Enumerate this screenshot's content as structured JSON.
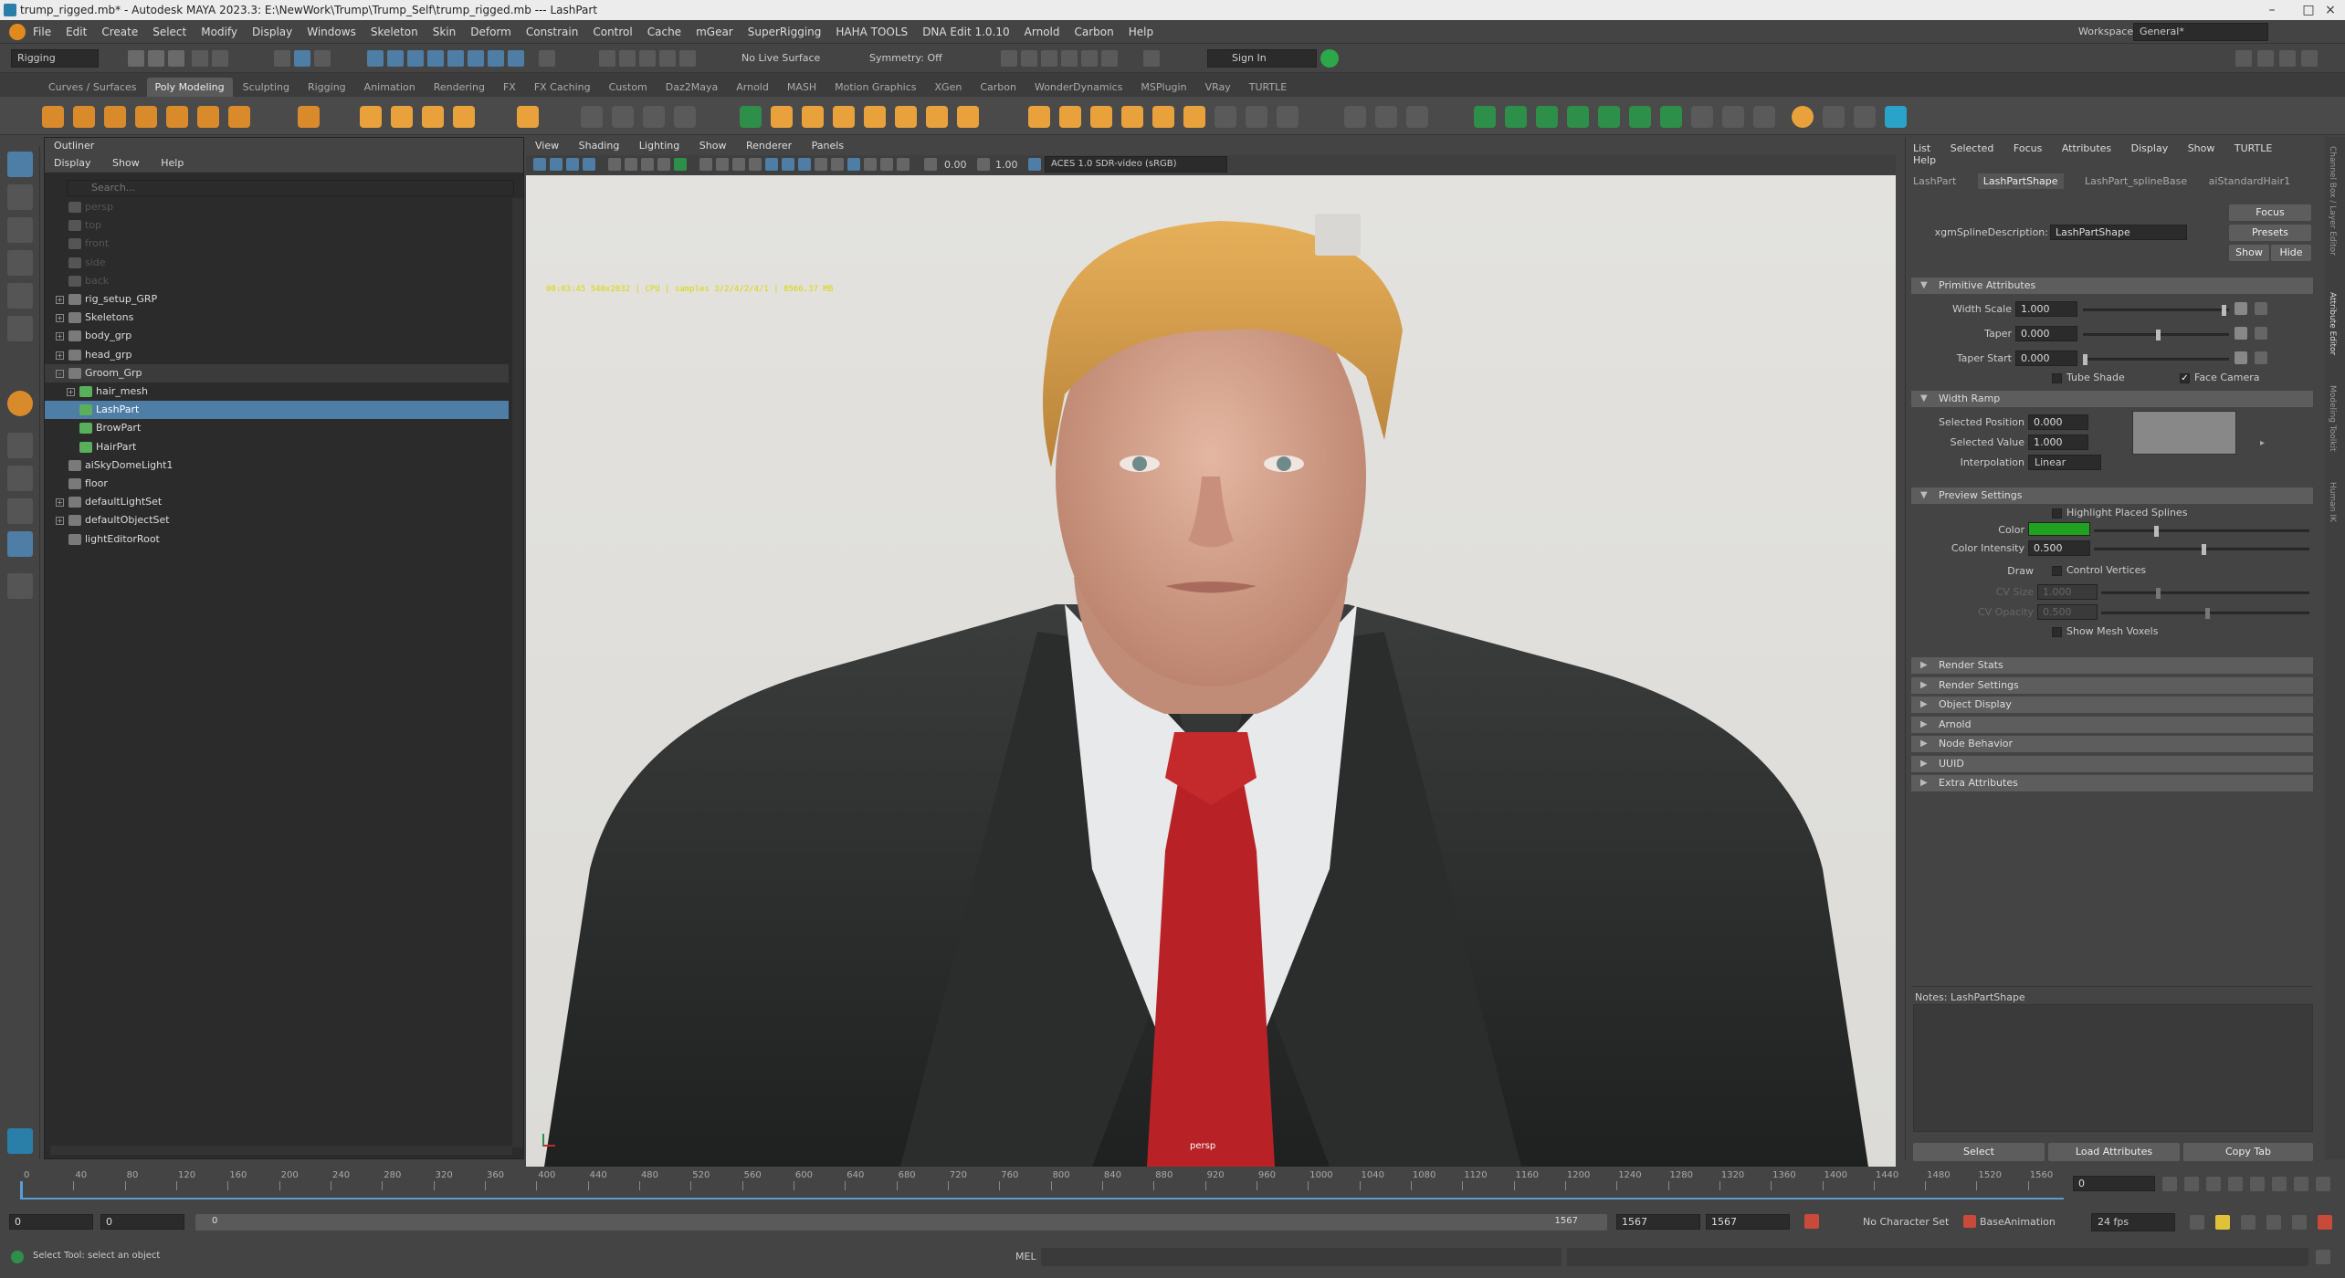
{
  "window": {
    "title": "trump_rigged.mb* - Autodesk MAYA 2023.3: E:\\NewWork\\Trump\\Trump_Self\\trump_rigged.mb  ---  LashPart"
  },
  "menubar": {
    "items": [
      "File",
      "Edit",
      "Create",
      "Select",
      "Modify",
      "Display",
      "Windows",
      "Skeleton",
      "Skin",
      "Deform",
      "Constrain",
      "Control",
      "Cache",
      "mGear",
      "SuperRigging",
      "HAHA TOOLS",
      "DNA Edit 1.0.10",
      "Arnold",
      "Carbon",
      "Help"
    ],
    "workspace_label": "Workspace:",
    "workspace_value": "General*"
  },
  "statusline": {
    "mode": "Rigging",
    "live_surface": "No Live Surface",
    "symmetry": "Symmetry: Off",
    "sign_in": "Sign In"
  },
  "shelf": {
    "tabs": [
      "Curves / Surfaces",
      "Poly Modeling",
      "Sculpting",
      "Rigging",
      "Animation",
      "Rendering",
      "FX",
      "FX Caching",
      "Custom",
      "Daz2Maya",
      "Arnold",
      "MASH",
      "Motion Graphics",
      "XGen",
      "Carbon",
      "WonderDynamics",
      "MSPlugin",
      "VRay",
      "TURTLE"
    ],
    "active": "Poly Modeling"
  },
  "outliner": {
    "title": "Outliner",
    "menu": [
      "Display",
      "Show",
      "Help"
    ],
    "search_placeholder": "Search...",
    "rows": [
      {
        "label": "persp",
        "indent": 0,
        "dim": true
      },
      {
        "label": "top",
        "indent": 0,
        "dim": true
      },
      {
        "label": "front",
        "indent": 0,
        "dim": true
      },
      {
        "label": "side",
        "indent": 0,
        "dim": true
      },
      {
        "label": "back",
        "indent": 0,
        "dim": true
      },
      {
        "label": "rig_setup_GRP",
        "indent": 0,
        "exp": "+"
      },
      {
        "label": "Skeletons",
        "indent": 0,
        "exp": "+"
      },
      {
        "label": "body_grp",
        "indent": 0,
        "exp": "+"
      },
      {
        "label": "head_grp",
        "indent": 0,
        "exp": "+"
      },
      {
        "label": "Groom_Grp",
        "indent": 0,
        "exp": "-",
        "grp": true
      },
      {
        "label": "hair_mesh",
        "indent": 1,
        "exp": "+"
      },
      {
        "label": "LashPart",
        "indent": 1,
        "sel": true
      },
      {
        "label": "BrowPart",
        "indent": 1
      },
      {
        "label": "HairPart",
        "indent": 1
      },
      {
        "label": "aiSkyDomeLight1",
        "indent": 0
      },
      {
        "label": "floor",
        "indent": 0
      },
      {
        "label": "defaultLightSet",
        "indent": 0,
        "exp": "+"
      },
      {
        "label": "defaultObjectSet",
        "indent": 0,
        "exp": "+"
      },
      {
        "label": "lightEditorRoot",
        "indent": 0
      }
    ]
  },
  "viewport": {
    "menu": [
      "View",
      "Shading",
      "Lighting",
      "Show",
      "Renderer",
      "Panels"
    ],
    "exposure": "0.00",
    "gamma": "1.00",
    "colorspace": "ACES 1.0 SDR-video (sRGB)",
    "hud": "00:03:45  540x2032  |  CPU  |  samples 3/2/4/2/4/1  |  8566.37 MB",
    "camera": "persp"
  },
  "attribute_editor": {
    "menu": [
      "List",
      "Selected",
      "Focus",
      "Attributes",
      "Display",
      "Show",
      "TURTLE",
      "Help"
    ],
    "tabs": [
      "LashPart",
      "LashPartShape",
      "LashPart_splineBase",
      "aiStandardHair1"
    ],
    "active_tab": "LashPartShape",
    "desc_label": "xgmSplineDescription:",
    "desc_value": "LashPartShape",
    "focus": "Focus",
    "presets": "Presets",
    "show": "Show",
    "hide": "Hide",
    "primitive": {
      "title": "Primitive Attributes",
      "width_scale_label": "Width Scale",
      "width_scale": "1.000",
      "taper_label": "Taper",
      "taper": "0.000",
      "taper_start_label": "Taper Start",
      "taper_start": "0.000",
      "tube_shade": "Tube Shade",
      "face_camera": "Face Camera"
    },
    "width_ramp": {
      "title": "Width Ramp",
      "sel_pos_label": "Selected Position",
      "sel_pos": "0.000",
      "sel_val_label": "Selected Value",
      "sel_val": "1.000",
      "interp_label": "Interpolation",
      "interp": "Linear"
    },
    "preview": {
      "title": "Preview Settings",
      "highlight": "Highlight Placed Splines",
      "color_label": "Color",
      "color_hex": "#1fa21f",
      "intensity_label": "Color Intensity",
      "intensity": "0.500",
      "draw_label": "Draw",
      "control_vertices": "Control Vertices",
      "cv_size_label": "CV Size",
      "cv_size": "1.000",
      "cv_opacity_label": "CV Opacity",
      "cv_opacity": "0.500",
      "mesh_voxels": "Show Mesh Voxels"
    },
    "collapsed": [
      "Render Stats",
      "Render Settings",
      "Object Display",
      "Arnold",
      "Node Behavior",
      "UUID",
      "Extra Attributes"
    ],
    "notes": "Notes:  LashPartShape",
    "buttons": {
      "select": "Select",
      "load": "Load Attributes",
      "copy": "Copy Tab"
    }
  },
  "right_strip": [
    "Channel Box / Layer Editor",
    "Attribute Editor",
    "Modeling Toolkit",
    "Human IK"
  ],
  "timeline": {
    "ticks": [
      "0",
      "40",
      "80",
      "120",
      "160",
      "200",
      "240",
      "280",
      "320",
      "360",
      "400",
      "440",
      "480",
      "520",
      "560",
      "600",
      "640",
      "680",
      "720",
      "760",
      "800",
      "840",
      "880",
      "920",
      "960",
      "1000",
      "1040",
      "1080",
      "1120",
      "1160",
      "1200",
      "1240",
      "1280",
      "1320",
      "1360",
      "1400",
      "1440",
      "1480",
      "1520",
      "1560"
    ],
    "current_frame": "0"
  },
  "range": {
    "start": "0",
    "anim_start": "0",
    "range_in": "0",
    "range_out": "1567",
    "anim_end": "1567",
    "end": "1567",
    "character": "No Character Set",
    "anim_layer": "BaseAnimation",
    "fps": "24 fps"
  },
  "commandline": {
    "help": "Select Tool: select an object",
    "mel": "MEL"
  }
}
